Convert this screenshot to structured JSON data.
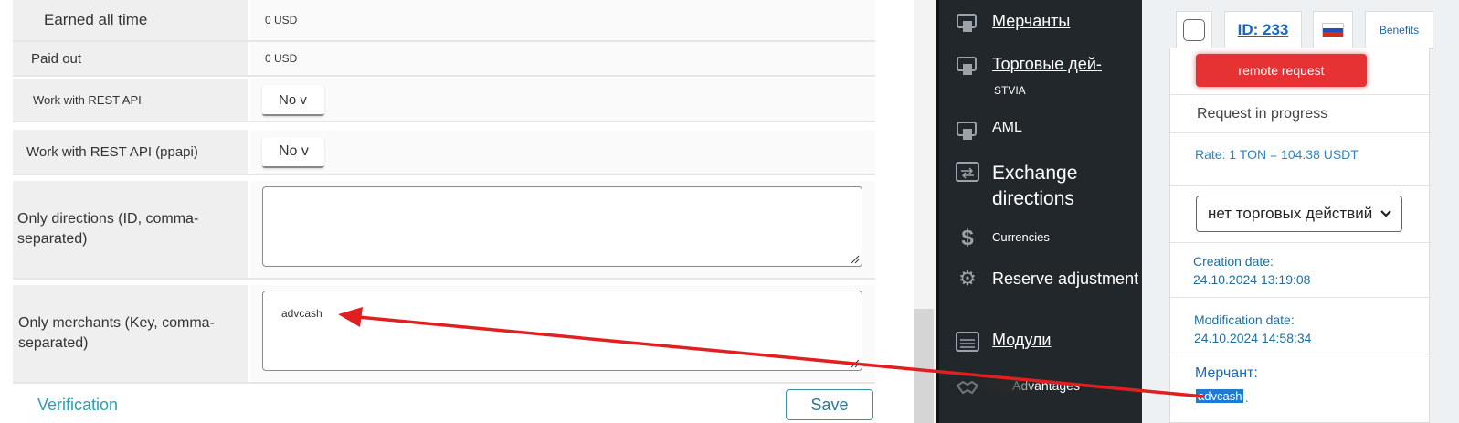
{
  "left_edge": {
    "link_text": ""
  },
  "settings": {
    "earned": {
      "label": "Earned all time",
      "value": "0 USD"
    },
    "paid": {
      "label": "Paid out",
      "value": "0 USD"
    },
    "rest_api": {
      "label": "Work with REST API",
      "value": "No v"
    },
    "rest_api_ppapi": {
      "label": "Work with REST API (ppapi)",
      "value": "No v"
    },
    "only_directions": {
      "label": "Only directions (ID, comma-separated)",
      "value": ""
    },
    "only_merchants": {
      "label": "Only merchants (Key, comma-separated)",
      "value": "advcash"
    },
    "verification_link": "Verification",
    "save_label": "Save"
  },
  "sidebar": {
    "merchants": "Мерчанты",
    "trades": "Торговые дей-",
    "trades_sub": "STVIA",
    "aml": "AML",
    "exchange": "Exchange directions",
    "currencies": "Currencies",
    "reserve": "Reserve adjustment",
    "modules": "Модули",
    "advantages": "Advantages"
  },
  "details": {
    "id_label": "ID: 233",
    "benefits": "Benefits",
    "remote_button": "remote request",
    "status": "Request in progress",
    "rate": "Rate: 1 TON = 104.38 USDT",
    "trade_select": "нет торговых действий",
    "creation_label": "Creation date:",
    "creation_value": "24.10.2024 13:19:08",
    "modification_label": "Modification date:",
    "modification_value": "24.10.2024 14:58:34",
    "merchant_label": "Мерчант:",
    "merchant_value": "advcash",
    "merchant_suffix": "."
  },
  "colors": {
    "sidebar_bg": "#22272b",
    "accent_teal": "#2aa1b3",
    "link_blue": "#1b67b8",
    "annotation_red": "#e02020",
    "remote_button": "#e63232"
  }
}
